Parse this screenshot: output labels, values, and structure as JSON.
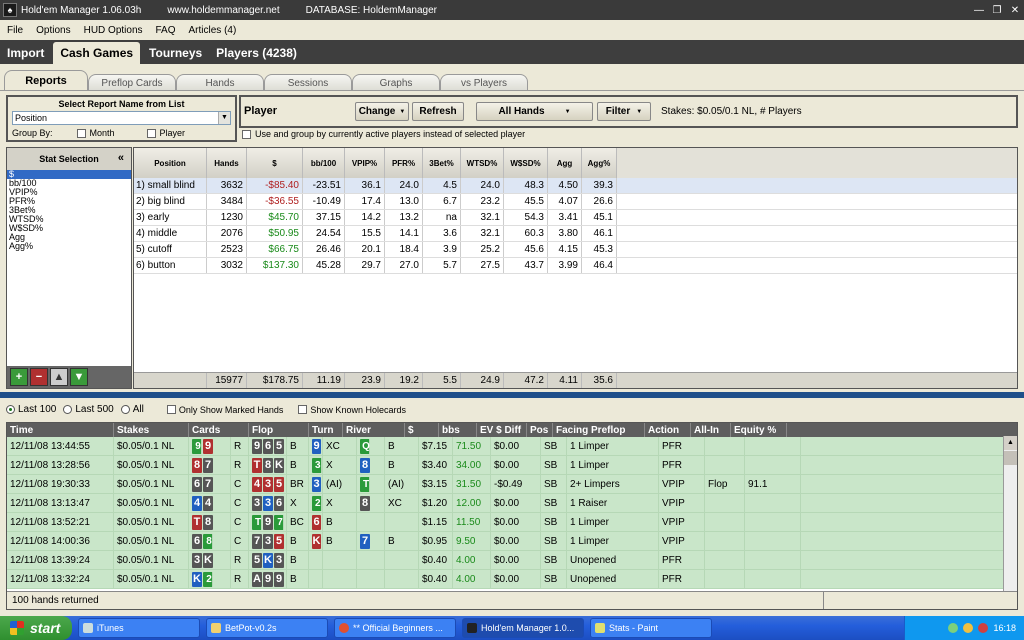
{
  "titlebar": {
    "app": "Hold'em Manager 1.06.03h",
    "site": "www.holdemmanager.net",
    "database": "DATABASE: HoldemManager"
  },
  "menu": [
    "File",
    "Options",
    "HUD Options",
    "FAQ",
    "Articles (4)"
  ],
  "nav_tabs": [
    "Import",
    "Cash Games",
    "Tourneys",
    "Players (4238)"
  ],
  "sub_tabs": [
    "Reports",
    "Preflop Cards",
    "Hands",
    "Sessions",
    "Graphs",
    "vs Players"
  ],
  "report": {
    "title": "Select Report Name from List",
    "selected": "Position",
    "group_by": "Group By:",
    "month": "Month",
    "player": "Player"
  },
  "player_bar": {
    "label": "Player",
    "change": "Change",
    "refresh": "Refresh",
    "all_hands": "All Hands",
    "filter": "Filter",
    "stakes": "Stakes: $0.05/0.1 NL, # Players",
    "use_group": "Use and group by currently active players instead of selected player"
  },
  "stat_selection": {
    "title": "Stat Selection",
    "collapse": "«",
    "items": [
      "$",
      "bb/100",
      "VPIP%",
      "PFR%",
      "3Bet%",
      "WTSD%",
      "W$SD%",
      "Agg",
      "Agg%"
    ]
  },
  "stats_table": {
    "headers": [
      "Position",
      "Hands",
      "$",
      "bb/100",
      "VPIP%",
      "PFR%",
      "3Bet%",
      "WTSD%",
      "W$SD%",
      "Agg",
      "Agg%"
    ],
    "rows": [
      [
        "1) small blind",
        "3632",
        "-$85.40",
        "-23.51",
        "36.1",
        "24.0",
        "4.5",
        "24.0",
        "48.3",
        "4.50",
        "39.3"
      ],
      [
        "2) big blind",
        "3484",
        "-$36.55",
        "-10.49",
        "17.4",
        "13.0",
        "6.7",
        "23.2",
        "45.5",
        "4.07",
        "26.6"
      ],
      [
        "3) early",
        "1230",
        "$45.70",
        "37.15",
        "14.2",
        "13.2",
        "na",
        "32.1",
        "54.3",
        "3.41",
        "45.1"
      ],
      [
        "4) middle",
        "2076",
        "$50.95",
        "24.54",
        "15.5",
        "14.1",
        "3.6",
        "32.1",
        "60.3",
        "3.80",
        "46.1"
      ],
      [
        "5) cutoff",
        "2523",
        "$66.75",
        "26.46",
        "20.1",
        "18.4",
        "3.9",
        "25.2",
        "45.6",
        "4.15",
        "45.3"
      ],
      [
        "6) button",
        "3032",
        "$137.30",
        "45.28",
        "29.7",
        "27.0",
        "5.7",
        "27.5",
        "43.7",
        "3.99",
        "46.4"
      ]
    ],
    "totals": [
      "",
      "15977",
      "$178.75",
      "11.19",
      "23.9",
      "19.2",
      "5.5",
      "24.9",
      "47.2",
      "4.11",
      "35.6"
    ]
  },
  "hand_filters": {
    "last100": "Last 100",
    "last500": "Last 500",
    "all": "All",
    "marked": "Only Show Marked Hands",
    "known": "Show Known Holecards"
  },
  "hands_table": {
    "headers": [
      "Time",
      "Stakes",
      "Cards",
      "Flop",
      "Turn",
      "River",
      "$",
      "bbs",
      "EV $ Diff",
      "Pos",
      "Facing Preflop",
      "Action",
      "All-In",
      "Equity %"
    ],
    "rows": [
      {
        "time": "12/11/08 13:44:55",
        "stakes": "$0.05/0.1 NL",
        "cards": [
          "9:c",
          "9:h"
        ],
        "pf": "R",
        "flop": [
          "9:s",
          "6:s",
          "5:s"
        ],
        "fa": "B",
        "turn": [
          "9:d"
        ],
        "ta": "XC",
        "river": [
          "Q:c"
        ],
        "ra": "B",
        "money": "$7.15",
        "bbs": "71.50",
        "ev": "$0.00",
        "pos": "SB",
        "facing": "1 Limper",
        "action": "PFR",
        "allin": "",
        "equity": ""
      },
      {
        "time": "12/11/08 13:28:56",
        "stakes": "$0.05/0.1 NL",
        "cards": [
          "8:h",
          "7:s"
        ],
        "pf": "R",
        "flop": [
          "T:h",
          "8:s",
          "K:s"
        ],
        "fa": "B",
        "turn": [
          "3:c"
        ],
        "ta": "X",
        "river": [
          "8:d"
        ],
        "ra": "B",
        "money": "$3.40",
        "bbs": "34.00",
        "ev": "$0.00",
        "pos": "SB",
        "facing": "1 Limper",
        "action": "PFR",
        "allin": "",
        "equity": ""
      },
      {
        "time": "12/11/08 19:30:33",
        "stakes": "$0.05/0.1 NL",
        "cards": [
          "6:s",
          "7:s"
        ],
        "pf": "C",
        "flop": [
          "4:h",
          "3:h",
          "5:h"
        ],
        "fa": "BR",
        "turn": [
          "3:d"
        ],
        "ta": "(AI)",
        "river": [
          "T:c"
        ],
        "ra": "(AI)",
        "money": "$3.15",
        "bbs": "31.50",
        "ev": "-$0.49",
        "pos": "SB",
        "facing": "2+ Limpers",
        "action": "VPIP",
        "allin": "Flop",
        "equity": "91.1"
      },
      {
        "time": "12/11/08 13:13:47",
        "stakes": "$0.05/0.1 NL",
        "cards": [
          "4:d",
          "4:s"
        ],
        "pf": "C",
        "flop": [
          "3:s",
          "3:d",
          "6:s"
        ],
        "fa": "X",
        "turn": [
          "2:c"
        ],
        "ta": "X",
        "river": [
          "8:s"
        ],
        "ra": "XC",
        "money": "$1.20",
        "bbs": "12.00",
        "ev": "$0.00",
        "pos": "SB",
        "facing": "1 Raiser",
        "action": "VPIP",
        "allin": "",
        "equity": ""
      },
      {
        "time": "12/11/08 13:52:21",
        "stakes": "$0.05/0.1 NL",
        "cards": [
          "T:h",
          "8:s"
        ],
        "pf": "C",
        "flop": [
          "T:c",
          "9:s",
          "7:c"
        ],
        "fa": "BC",
        "turn": [
          "6:h"
        ],
        "ta": "B",
        "river": [],
        "ra": "",
        "money": "$1.15",
        "bbs": "11.50",
        "ev": "$0.00",
        "pos": "SB",
        "facing": "1 Limper",
        "action": "VPIP",
        "allin": "",
        "equity": ""
      },
      {
        "time": "12/11/08 14:00:36",
        "stakes": "$0.05/0.1 NL",
        "cards": [
          "6:s",
          "8:c"
        ],
        "pf": "C",
        "flop": [
          "7:s",
          "3:s",
          "5:h"
        ],
        "fa": "B",
        "turn": [
          "K:h"
        ],
        "ta": "B",
        "river": [
          "7:d"
        ],
        "ra": "B",
        "money": "$0.95",
        "bbs": "9.50",
        "ev": "$0.00",
        "pos": "SB",
        "facing": "1 Limper",
        "action": "VPIP",
        "allin": "",
        "equity": ""
      },
      {
        "time": "12/11/08 13:39:24",
        "stakes": "$0.05/0.1 NL",
        "cards": [
          "3:s",
          "K:s"
        ],
        "pf": "R",
        "flop": [
          "5:s",
          "K:d",
          "3:s"
        ],
        "fa": "B",
        "turn": [],
        "ta": "",
        "river": [],
        "ra": "",
        "money": "$0.40",
        "bbs": "4.00",
        "ev": "$0.00",
        "pos": "SB",
        "facing": "Unopened",
        "action": "PFR",
        "allin": "",
        "equity": ""
      },
      {
        "time": "12/11/08 13:32:24",
        "stakes": "$0.05/0.1 NL",
        "cards": [
          "K:d",
          "2:c"
        ],
        "pf": "R",
        "flop": [
          "A:s",
          "9:s",
          "9:s"
        ],
        "fa": "B",
        "turn": [],
        "ta": "",
        "river": [],
        "ra": "",
        "money": "$0.40",
        "bbs": "4.00",
        "ev": "$0.00",
        "pos": "SB",
        "facing": "Unopened",
        "action": "PFR",
        "allin": "",
        "equity": ""
      }
    ],
    "footer": "100 hands returned"
  },
  "taskbar": {
    "start": "start",
    "items": [
      "iTunes",
      "BetPot-v0.2s",
      "** Official Beginners ...",
      "Hold'em Manager 1.0...",
      "Stats - Paint"
    ],
    "clock": "16:18"
  },
  "colors": {
    "accent": "#316ac5",
    "positive": "#1a8a1a",
    "negative": "#b02020",
    "row_green": "#c9e6c9"
  }
}
